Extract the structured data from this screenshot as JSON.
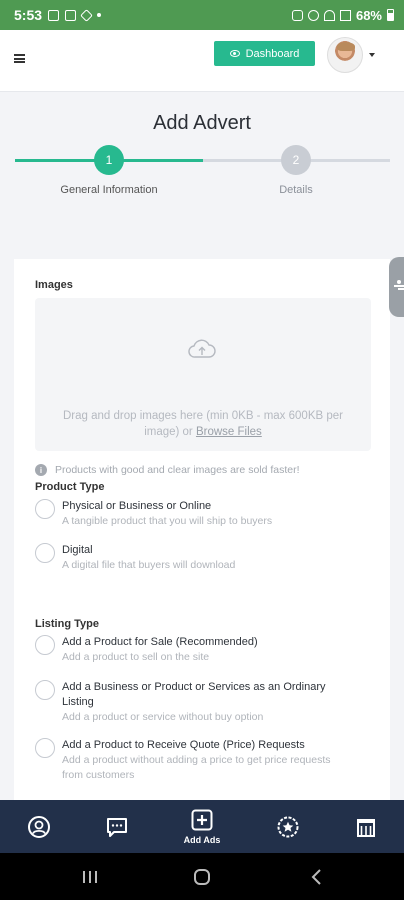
{
  "status_bar": {
    "time": "5:53",
    "battery": "68%"
  },
  "top_bar": {
    "dashboard_label": "Dashboard"
  },
  "page": {
    "title": "Add Advert"
  },
  "stepper": {
    "steps": [
      {
        "number": "1",
        "label": "General Information",
        "active": true
      },
      {
        "number": "2",
        "label": "Details",
        "active": false
      }
    ]
  },
  "form": {
    "images_label": "Images",
    "dropzone_text": "Drag and drop images here (min 0KB - max 600KB per image) or ",
    "dropzone_link": "Browse Files",
    "tip_text": "Products with good and clear images are sold faster!",
    "product_type_label": "Product Type",
    "product_types": [
      {
        "title": "Physical or Business or Online",
        "desc": "A tangible product that you will ship to buyers"
      },
      {
        "title": "Digital",
        "desc": "A digital file that buyers will download"
      }
    ],
    "listing_type_label": "Listing Type",
    "listing_types": [
      {
        "title": "Add a Product for Sale (Recommended)",
        "desc": "Add a product to sell on the site"
      },
      {
        "title": "Add a Business or Product or Services as an Ordinary Listing",
        "desc": "Add a product or service without buy option"
      },
      {
        "title": "Add a Product to Receive Quote (Price) Requests",
        "desc": "Add a product without adding a price to get price requests from customers"
      }
    ]
  },
  "bottom_nav": {
    "add_ads_label": "Add Ads"
  },
  "colors": {
    "accent": "#27b98f",
    "status_bar": "#4f9a52",
    "bottom_nav": "#22304a"
  }
}
